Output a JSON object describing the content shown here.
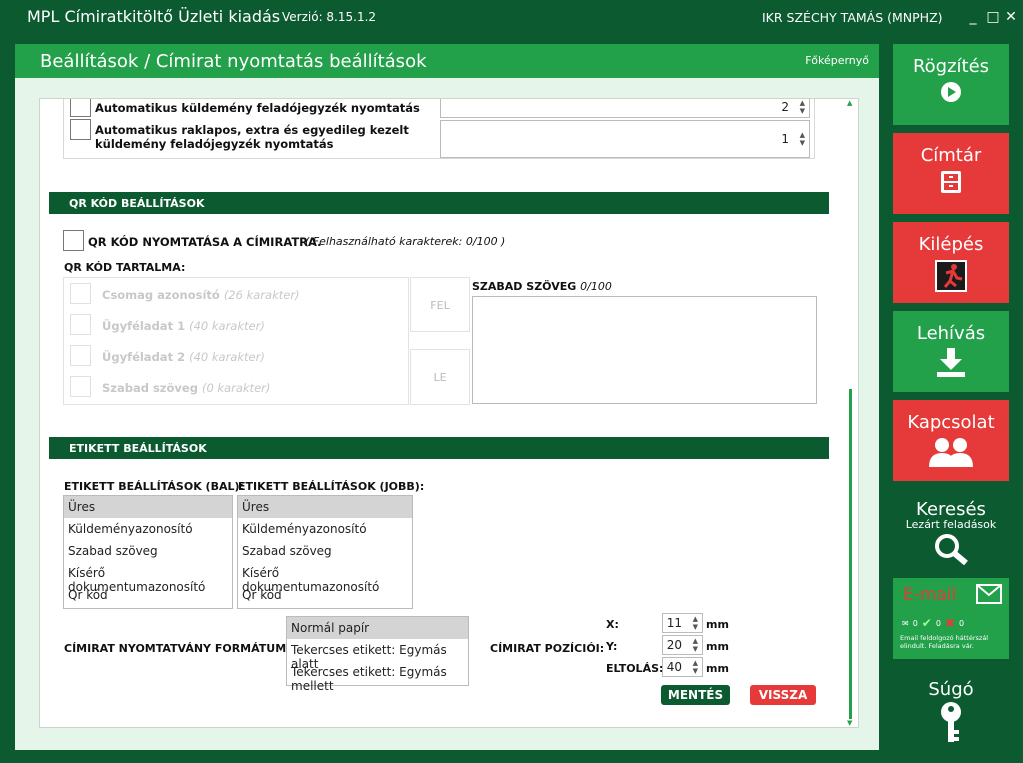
{
  "window": {
    "app_title": "MPL Címiratkitöltő Üzleti kiadás",
    "version": "Verzió: 8.15.1.2",
    "user": "IKR SZÉCHY TAMÁS (MNPHZ)",
    "minimize": "_",
    "maximize": "□",
    "close": "✕"
  },
  "header": {
    "breadcrumb": "Beállítások / Címirat nyomtatás beállítások",
    "home_link": "Főképernyő"
  },
  "top_options": [
    {
      "label": "Automatikus küldemény feladójegyzék nyomtatás",
      "value": "2"
    },
    {
      "label": "Automatikus raklapos, extra és egyedileg kezelt küldemény feladójegyzék nyomtatás",
      "value": "1"
    }
  ],
  "qr": {
    "section_title": "QR KÓD BEÁLLÍTÁSOK",
    "print_label": "QR KÓD NYOMTATÁSA A CÍMIRATRA.",
    "print_note": "( Felhasználható karakterek: 0/100 )",
    "content_title": "QR KÓD TARTALMA:",
    "items": [
      {
        "label": "Csomag azonosító",
        "note": "(26 karakter)"
      },
      {
        "label": "Ügyféladat 1",
        "note": "(40 karakter)"
      },
      {
        "label": "Ügyféladat 2",
        "note": "(40 karakter)"
      },
      {
        "label": "Szabad szöveg",
        "note": "(0 karakter)"
      }
    ],
    "up_label": "FEL",
    "down_label": "LE",
    "free_text_label": "SZABAD SZÖVEG",
    "free_text_count": "0/100",
    "free_text_value": ""
  },
  "label": {
    "section_title": "ETIKETT BEÁLLÍTÁSOK",
    "left_title": "ETIKETT BEÁLLÍTÁSOK (BAL):",
    "right_title": "ETIKETT BEÁLLÍTÁSOK (JOBB):",
    "left_options": [
      "Üres",
      "Küldeményazonosító",
      "Szabad szöveg",
      "Kísérő dokumentumazonosító",
      "Qr kód"
    ],
    "right_options": [
      "Üres",
      "Küldeményazonosító",
      "Szabad szöveg",
      "Kísérő dokumentumazonosító",
      "Qr kód"
    ],
    "left_selected": "Üres",
    "right_selected": "Üres"
  },
  "format": {
    "title": "CÍMIRAT NYOMTATVÁNY FORMÁTUMA:",
    "options": [
      "Normál papír",
      "Tekercses etikett: Egymás alatt",
      "Tekercses etikett: Egymás mellett"
    ],
    "selected": "Normál papír"
  },
  "position": {
    "title": "CÍMIRAT POZÍCIÓI:",
    "x_label": "X:",
    "x_value": "11",
    "y_label": "Y:",
    "y_value": "20",
    "offset_label": "ELTOLÁS:",
    "offset_value": "40",
    "unit": "mm"
  },
  "buttons": {
    "save": "MENTÉS",
    "back": "VISSZA"
  },
  "sidebar": {
    "record": "Rögzítés",
    "addressbook": "Címtár",
    "exit": "Kilépés",
    "download": "Lehívás",
    "contact": "Kapcsolat",
    "search": "Keresés",
    "search_sub": "Lezárt feladások",
    "email": "E-mail",
    "email_counts": [
      "0",
      "0",
      "0"
    ],
    "email_note": "Email feldolgozó háttérszál elindult. Feladásra vár.",
    "help": "Súgó"
  },
  "colors": {
    "dark_green": "#0b5a30",
    "green": "#23a04a",
    "red": "#e63a3a"
  }
}
